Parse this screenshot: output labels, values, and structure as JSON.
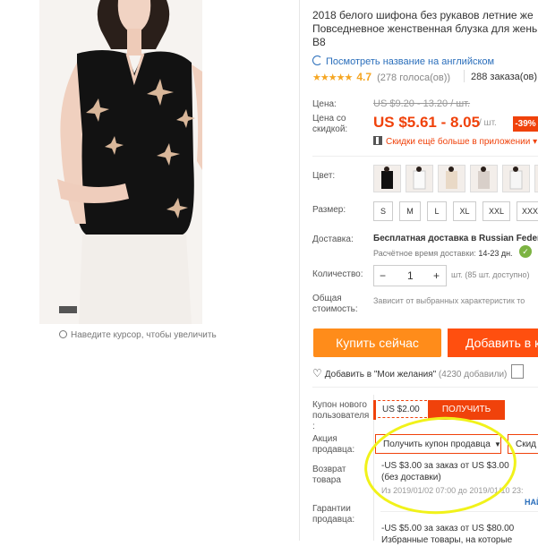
{
  "product": {
    "title_line1": "2018 белого шифона без рукавов летние же",
    "title_line2": "Повседневное женственная блузка для жень",
    "title_line3": "B8",
    "translate_link": "Посмотреть название на английском",
    "stars": "★★★★★",
    "rating": "4.7",
    "votes": "(278 голоса(ов))",
    "orders": "288 заказа(ов)"
  },
  "gallery": {
    "zoom_hint": "Наведите курсор, чтобы увеличить"
  },
  "price": {
    "label_price": "Цена:",
    "old_price": "US $9.20 - 13.20 / шт.",
    "label_discount_price": "Цена со скидкой:",
    "new_price": "US $5.61 - 8.05",
    "per_unit": "/ шт.",
    "discount_badge": "-39%",
    "app_discount": "Скидки ещё больше в приложении ▾"
  },
  "options": {
    "color_label": "Цвет:",
    "size_label": "Размер:",
    "sizes": [
      "S",
      "M",
      "L",
      "XL",
      "XXL",
      "XXX"
    ]
  },
  "shipping": {
    "label": "Доставка:",
    "value": "Бесплатная доставка в Russian Federa",
    "time_label": "Расчётное время доставки:",
    "time_value": "14-23 дн."
  },
  "quantity": {
    "label": "Количество:",
    "minus": "−",
    "value": "1",
    "plus": "+",
    "note": "шт. (85 шт. доступно)"
  },
  "total": {
    "label": "Общая стоимость:",
    "note": "Зависит от выбранных характеристик то"
  },
  "actions": {
    "buy_now": "Купить сейчас",
    "add_to_cart": "Добавить в к",
    "wishlist": "Добавить в \"Мои желания\"",
    "wishlist_count": "(4230 добавили)"
  },
  "coupons": {
    "new_user_label": "Купон нового пользователя :",
    "new_user_value": "US $2.00",
    "get_button": "ПОЛУЧИТЬ",
    "seller_label": "Акция продавца:",
    "seller_coupon_button": "Получить купон продавца",
    "seller_coupon_button2": "Скид",
    "return_label": "Возврат товара",
    "return_offer_line1": "-US $3.00 за заказ от US $3.00",
    "return_offer_line2": "(без доставки)",
    "return_offer_dates": "Из 2019/01/02 07:00 до 2019/01/10 23:",
    "more_link": "НАЙ",
    "guarantee_label": "Гарантии продавца:",
    "offer2_line1": "-US $5.00 за заказ от US $80.00",
    "offer2_line2": "Избранные товары, на которые"
  },
  "colors": {
    "accent": "#f0420b",
    "buy_button": "#ff8c1a",
    "cart_button": "#ff4f0f",
    "link": "#2a6ebb",
    "star": "#f5a623",
    "highlight": "#f1f21a"
  }
}
